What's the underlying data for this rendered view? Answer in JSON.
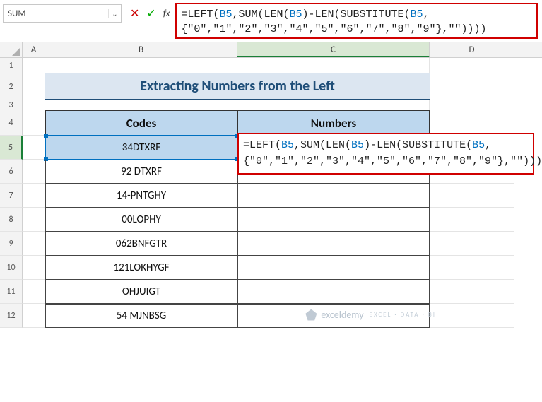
{
  "nameBox": "SUM",
  "formulaBar": "=LEFT(B5,SUM(LEN(B5)-LEN(SUBSTITUTE(B5,{\"0\",\"1\",\"2\",\"3\",\"4\",\"5\",\"6\",\"7\",\"8\",\"9\"},\"\"))))",
  "columns": [
    "A",
    "B",
    "C",
    "D"
  ],
  "rows": [
    "1",
    "2",
    "3",
    "4",
    "5",
    "6",
    "7",
    "8",
    "9",
    "10",
    "11",
    "12"
  ],
  "title": "Extracting Numbers from the Left",
  "headers": {
    "codes": "Codes",
    "numbers": "Numbers"
  },
  "codes": [
    "34DTXRF",
    "92 DTXRF",
    "14-PNTGHY",
    "00LOPHY",
    "062BNFGTR",
    "121LOKHYGF",
    "OHJUIGT",
    "54 MJNBSG"
  ],
  "inlineFormula": "=LEFT(B5,SUM(LEN(B5)-LEN(SUBSTITUTE(B5,{\"0\",\"1\",\"2\",\"3\",\"4\",\"5\",\"6\",\"7\",\"8\",\"9\"},\"\"))))",
  "watermark": {
    "name": "exceldemy",
    "sub": "EXCEL · DATA · BI"
  }
}
